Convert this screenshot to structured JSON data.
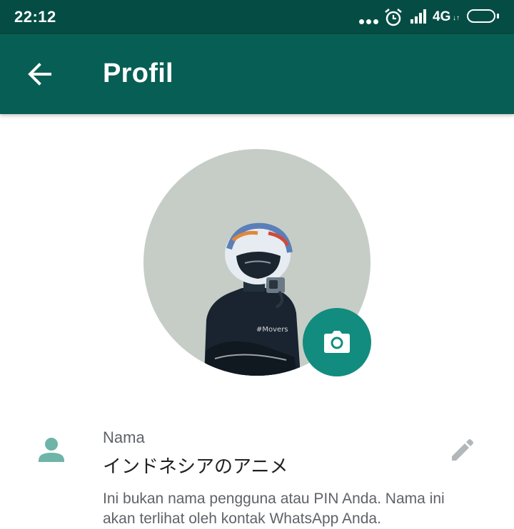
{
  "status_bar": {
    "time": "22:12",
    "network": "4G",
    "network_arrows": "↓↑",
    "icons": [
      "more-dots-icon",
      "alarm-icon",
      "signal-icon",
      "battery-icon"
    ]
  },
  "app_bar": {
    "title": "Profil",
    "back_icon": "arrow-back-icon",
    "color": "#075e54"
  },
  "profile": {
    "avatar_description": "profile-photo",
    "camera_icon": "camera-icon",
    "accent": "#128c7e"
  },
  "name_section": {
    "label": "Nama",
    "value": "インドネシアのアニメ",
    "hint": "Ini bukan nama pengguna atau PIN Anda. Nama ini akan terlihat oleh kontak WhatsApp Anda.",
    "person_icon": "person-icon",
    "edit_icon": "pencil-icon"
  }
}
